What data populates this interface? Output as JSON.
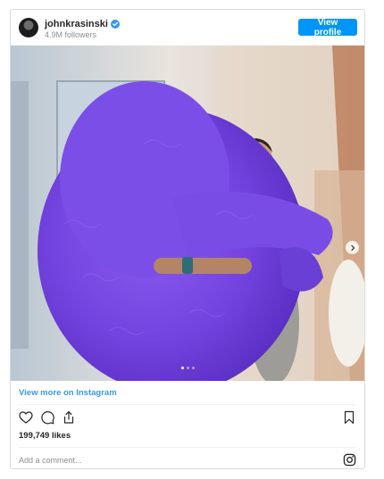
{
  "header": {
    "username": "johnkrasinski",
    "verified_icon": "verified-badge-icon",
    "followers": "4.9M followers",
    "view_profile_label": "View profile"
  },
  "photo": {
    "description_icon": "post-photo",
    "carousel_count": 3,
    "carousel_active_index": 0,
    "next_icon": "chevron-right-icon"
  },
  "view_more_label": "View more on Instagram",
  "actions": {
    "icons": [
      "heart-icon",
      "comment-icon",
      "share-icon",
      "bookmark-icon"
    ]
  },
  "likes_text": "199,749 likes",
  "comment": {
    "placeholder": "Add a comment...",
    "glyph_icon": "instagram-icon"
  },
  "colors": {
    "brand_blue": "#0095f6",
    "link_blue": "#3897f0",
    "verified_blue": "#3897f0",
    "muted_text": "#8e8e8e",
    "border": "#dbdbdb"
  }
}
